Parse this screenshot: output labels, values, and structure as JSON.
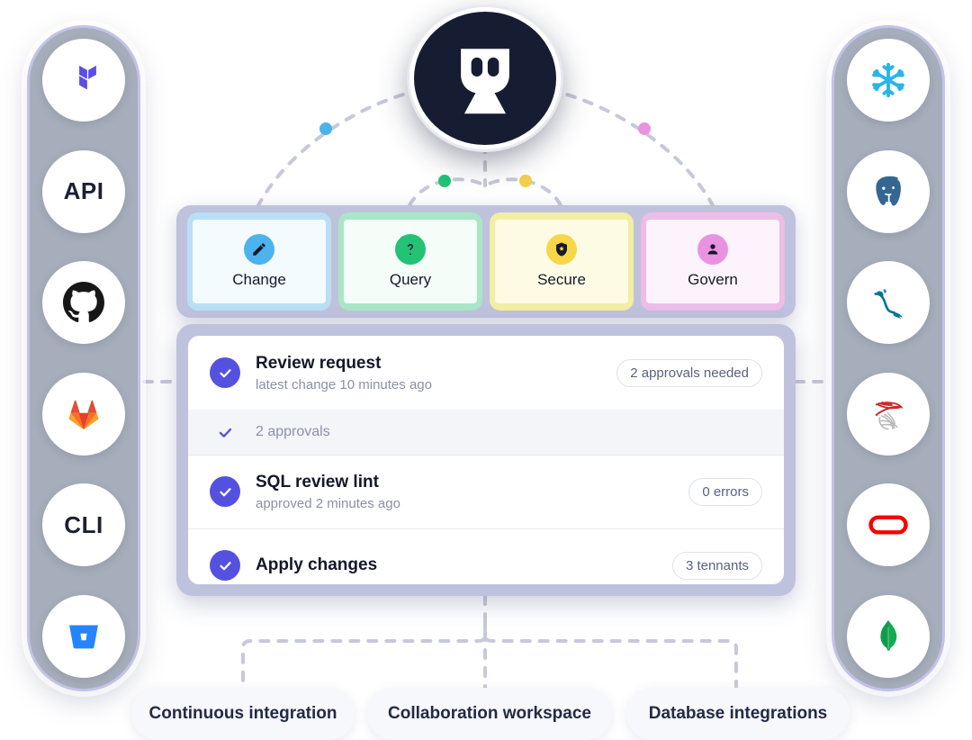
{
  "hub": {
    "name": "platform-hub",
    "logo_icon": "robot-mask-icon",
    "background": "#161d33"
  },
  "left_rail": {
    "name": "integrations-rail-left",
    "items": [
      {
        "icon": "terraform-icon",
        "label": "Terraform",
        "text": "",
        "color": "#5c4ee5"
      },
      {
        "icon": "api-text-icon",
        "label": "API",
        "text": "API",
        "color": "#1c2033"
      },
      {
        "icon": "github-icon",
        "label": "GitHub",
        "text": "",
        "color": "#181717"
      },
      {
        "icon": "gitlab-icon",
        "label": "GitLab",
        "text": "",
        "color": "#e24329"
      },
      {
        "icon": "cli-text-icon",
        "label": "CLI",
        "text": "CLI",
        "color": "#1c2033"
      },
      {
        "icon": "bitbucket-icon",
        "label": "Bitbucket",
        "text": "",
        "color": "#2684ff"
      }
    ]
  },
  "right_rail": {
    "name": "databases-rail-right",
    "items": [
      {
        "icon": "snowflake-icon",
        "label": "Snowflake",
        "text": "",
        "color": "#29b5e8"
      },
      {
        "icon": "postgresql-icon",
        "label": "PostgreSQL",
        "text": "",
        "color": "#336791"
      },
      {
        "icon": "mysql-icon",
        "label": "MySQL",
        "text": "",
        "color": "#00758f"
      },
      {
        "icon": "sqlserver-icon",
        "label": "SQL Server",
        "text": "",
        "color": "#cc2927"
      },
      {
        "icon": "oracle-icon",
        "label": "Oracle",
        "text": "",
        "color": "#f80000"
      },
      {
        "icon": "mongodb-icon",
        "label": "MongoDB",
        "text": "",
        "color": "#13aa52"
      }
    ]
  },
  "pillars": [
    {
      "label": "Change",
      "icon": "pencil-icon",
      "accent": "#4cb3ee",
      "glow": "#b9dff6",
      "tint": "#f3fbff"
    },
    {
      "label": "Query",
      "icon": "question-mark-icon",
      "accent": "#23c275",
      "glow": "#a9e6c6",
      "tint": "#f5fdf8"
    },
    {
      "label": "Secure",
      "icon": "shield-icon",
      "accent": "#f7d64a",
      "glow": "#f4eda4",
      "tint": "#fdfbe4"
    },
    {
      "label": "Govern",
      "icon": "person-icon",
      "accent": "#e993e0",
      "glow": "#edbde8",
      "tint": "#fdf3fc"
    }
  ],
  "tasks": [
    {
      "type": "main",
      "title": "Review request",
      "subtitle": "latest change 10 minutes ago",
      "badge": "2 approvals needed",
      "check": "check-filled",
      "name": "task-review-request"
    },
    {
      "type": "sub",
      "title": "2 approvals",
      "subtitle": "",
      "badge": "",
      "check": "check-bare",
      "name": "task-approvals"
    },
    {
      "type": "main",
      "title": "SQL review lint",
      "subtitle": "approved 2 minutes ago",
      "badge": "0 errors",
      "check": "check-filled",
      "name": "task-sql-review-lint"
    },
    {
      "type": "main",
      "title": "Apply changes",
      "subtitle": "",
      "badge": "3 tennants",
      "check": "check-filled",
      "name": "task-apply-changes"
    }
  ],
  "footer_pills": [
    {
      "label": "Continuous integration"
    },
    {
      "label": "Collaboration workspace"
    },
    {
      "label": "Database integrations"
    }
  ],
  "colors": {
    "panel_shell": "#bfc2dc",
    "check_purple": "#5551e0",
    "connector": "#c6c9d8",
    "rail_body": "#a7aebb",
    "rail_border": "#c3c2e8",
    "dot_change": "#4cb3ee",
    "dot_query": "#23c275",
    "dot_secure": "#f5cf4d",
    "dot_govern": "#e993e0"
  }
}
